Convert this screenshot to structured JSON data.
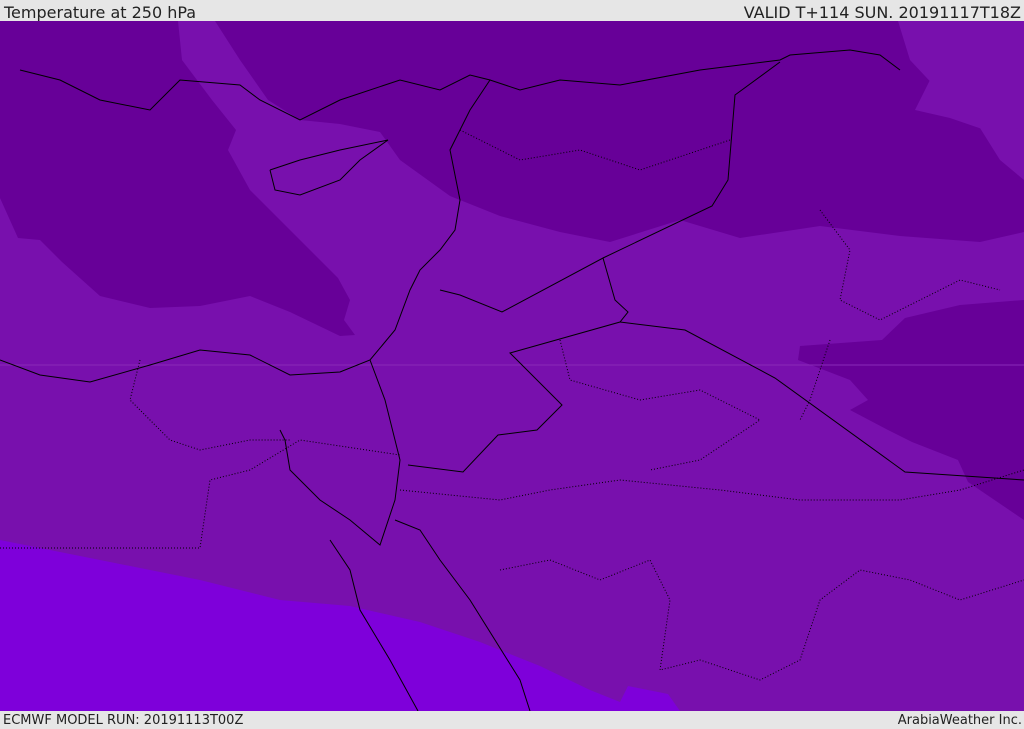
{
  "header": {
    "title": "Temperature at 250 hPa",
    "valid": "VALID T+114 SUN. 20191117T18Z"
  },
  "footer": {
    "model_run": "ECMWF MODEL RUN: 20191113T00Z",
    "brand": "ArabiaWeather Inc."
  },
  "colors": {
    "cold_band": "#670098",
    "mid_band": "#7810ad",
    "warm_band": "#7e00da",
    "border": "#000000"
  }
}
